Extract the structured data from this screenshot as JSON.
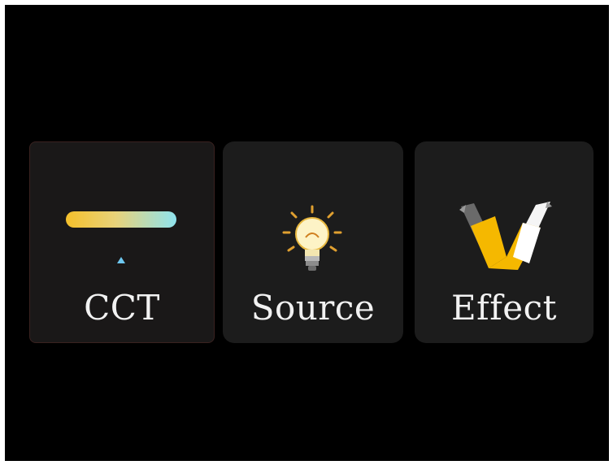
{
  "tiles": [
    {
      "id": "cct",
      "label": "CCT",
      "icon": "cct-gradient-icon",
      "selected": true
    },
    {
      "id": "source",
      "label": "Source",
      "icon": "lightbulb-icon",
      "selected": false
    },
    {
      "id": "effect",
      "label": "Effect",
      "icon": "effect-icon",
      "selected": false
    }
  ],
  "colors": {
    "background": "#000000",
    "tile": "#1c1c1c",
    "text": "#f2f2f2",
    "gradient_warm": "#f5c02b",
    "gradient_cool": "#8fe3ee",
    "indicator": "#6ec8f0",
    "effect_yellow": "#f5b800"
  }
}
